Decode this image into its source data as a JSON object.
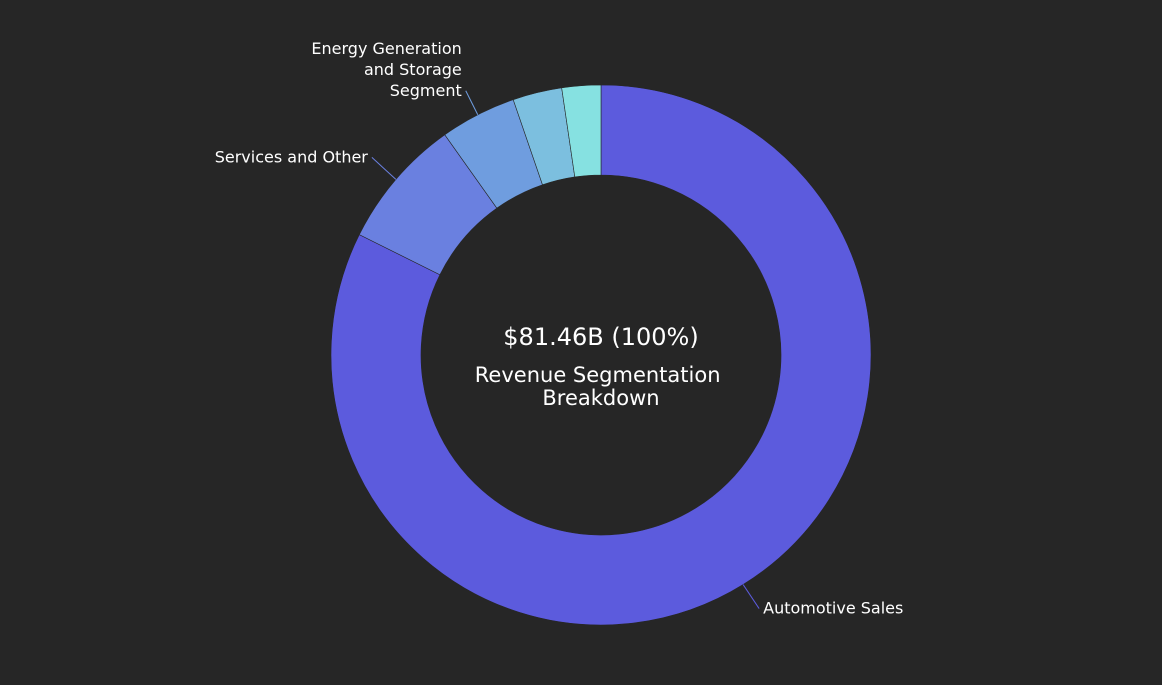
{
  "chart_data": {
    "type": "pie",
    "style": "donut",
    "center_value": "$81.46B (100%)",
    "center_title_lines": [
      "Revenue Segmentation",
      "Breakdown"
    ],
    "slices": [
      {
        "label": "Automotive Sales",
        "value": 64.08,
        "color": "#5c5bdd"
      },
      {
        "label": "Services and Other",
        "value": 6.09,
        "color": "#6a80e0"
      },
      {
        "label": "Energy Generation and Storage Segment",
        "label_lines": [
          "Energy Generation",
          "and Storage",
          "Segment"
        ],
        "value": 3.54,
        "color": "#6f9ddf"
      },
      {
        "label": "",
        "value": 2.29,
        "color": "#7cbfdf"
      },
      {
        "label": "",
        "value": 1.81,
        "color": "#86e1e1"
      }
    ],
    "legend": "none",
    "grid": false
  },
  "colors": {
    "background": "#262626",
    "text": "#ffffff",
    "leader_line": "#6a80e0"
  }
}
